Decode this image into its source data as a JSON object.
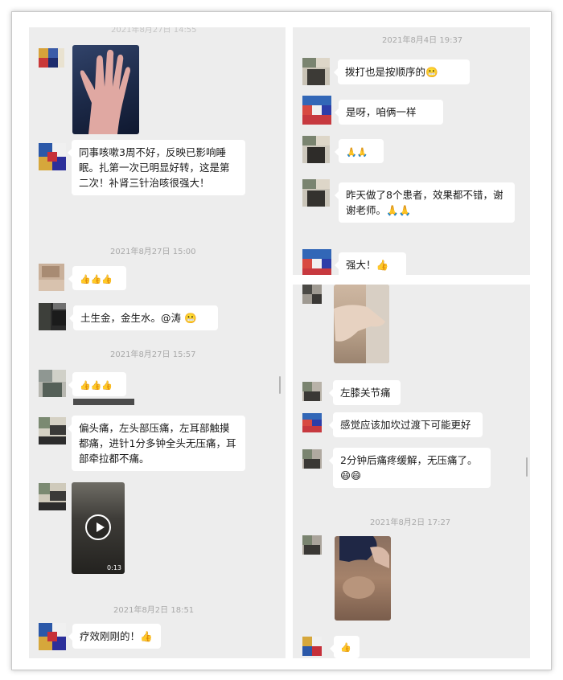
{
  "colors": {
    "panel": "#ededed",
    "bubble": "#ffffff",
    "timestamp": "#a8a8a8",
    "text": "#1a1a1a"
  },
  "left_top": {
    "header_ts": "2021年8月27日 14:55",
    "msg_colleague": "同事咳嗽3周不好，反映已影响睡眠。扎第一次已明显好转，这是第二次！补肾三针治咳很强大！",
    "ts1": "2021年8月27日 15:00",
    "thumbs3": "👍👍👍",
    "msg_earth": "土生金，金生水。@涛 😬",
    "ts2": "2021年8月27日 15:57",
    "thumbs3b": "👍👍👍"
  },
  "left_bottom": {
    "msg_headache": "偏头痛，左头部压痛，左耳部触摸都痛，进针1分多钟全头无压痛，耳部牵拉都不痛。",
    "video_duration": "0:13",
    "ts": "2021年8月2日 18:51",
    "msg_effect": "疗效刚刚的！👍"
  },
  "right_top": {
    "ts": "2021年8月4日 19:37",
    "msg1": "拨打也是按顺序的😬",
    "msg2": "是呀，咱俩一样",
    "msg3": "🙏🙏",
    "msg4": "昨天做了8个患者，效果都不错，谢谢老师。🙏🙏",
    "msg5": "强大！👍"
  },
  "right_bottom": {
    "msg_knee": "左膝关节痛",
    "msg_suggest": "感觉应该加坎过渡下可能更好",
    "msg_relief": "2分钟后痛疼缓解，无压痛了。😄😄",
    "ts": "2021年8月2日 17:27",
    "thumb": "👍"
  }
}
